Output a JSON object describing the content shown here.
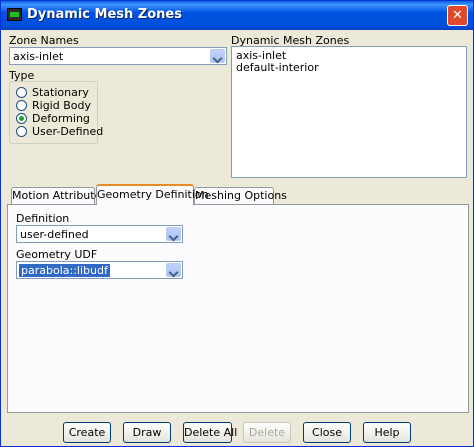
{
  "window": {
    "title": "Dynamic Mesh Zones",
    "close_glyph": "✕"
  },
  "zone_names": {
    "label": "Zone Names",
    "selected": "axis-inlet"
  },
  "type_group": {
    "label": "Type",
    "options": [
      {
        "label": "Stationary",
        "selected": false
      },
      {
        "label": "Rigid Body",
        "selected": false
      },
      {
        "label": "Deforming",
        "selected": true
      },
      {
        "label": "User-Defined",
        "selected": false
      }
    ]
  },
  "dynamic_mesh_zones": {
    "label": "Dynamic Mesh Zones",
    "items": [
      "axis-inlet",
      "default-interior"
    ]
  },
  "tabs": [
    {
      "label": "Motion Attributes",
      "active": false
    },
    {
      "label": "Geometry Definition",
      "active": true
    },
    {
      "label": "Meshing Options",
      "active": false
    }
  ],
  "geometry": {
    "definition_label": "Definition",
    "definition_value": "user-defined",
    "udf_label": "Geometry UDF",
    "udf_value": "parabola::libudf"
  },
  "buttons": {
    "create": "Create",
    "draw": "Draw",
    "delete_all": "Delete All",
    "delete": "Delete",
    "close": "Close",
    "help": "Help"
  }
}
